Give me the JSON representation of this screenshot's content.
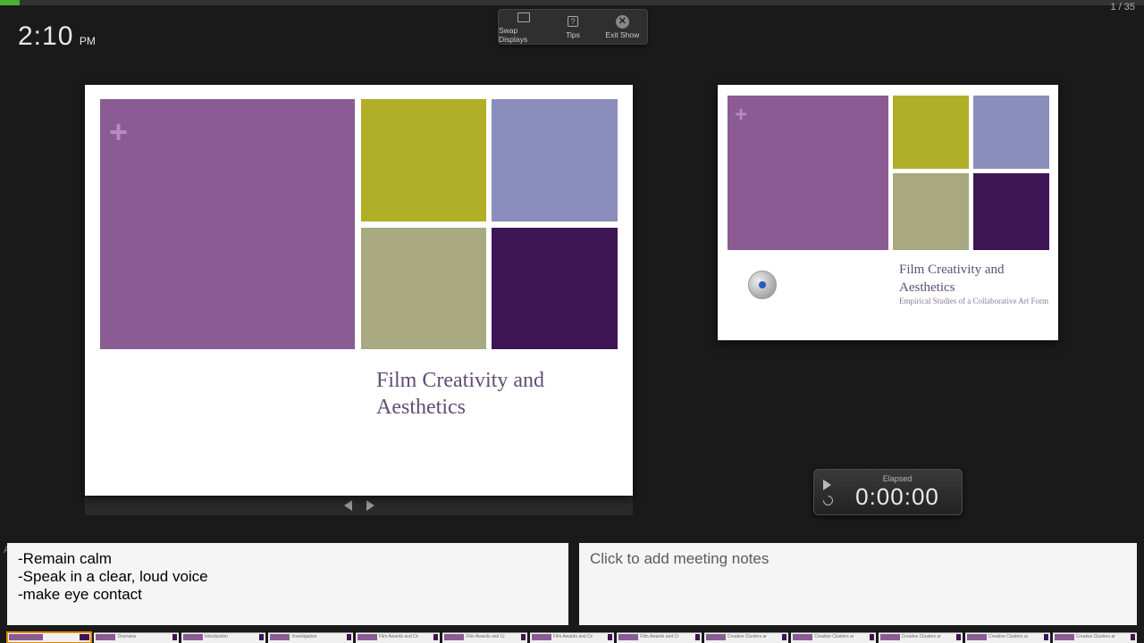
{
  "progress": {
    "current": 1,
    "total": 35,
    "label": "1 / 35"
  },
  "clock": {
    "time": "2:10",
    "ampm": "PM"
  },
  "toolbar": {
    "swap": "Swap Displays",
    "tips": "Tips",
    "exit": "Exit Show"
  },
  "current_slide": {
    "title": "Film Creativity and Aesthetics"
  },
  "next_slide": {
    "title": "Film Creativity and Aesthetics",
    "subtitle": "Empirical Studies of a Collaborative Art Form"
  },
  "timer": {
    "label": "Elapsed",
    "value": "0:00:00"
  },
  "presenter_notes": [
    "-Remain calm",
    "-Speak in a clear, loud voice",
    "-make eye contact"
  ],
  "meeting_notes_placeholder": "Click to add meeting notes",
  "thumbs": [
    "",
    "Overview",
    "Introduction",
    "Investigation",
    "Film Awards and Creative",
    "Film Awards and Creative",
    "Film Awards and Creative",
    "Film Awards and Creative",
    "Creative Clusters and",
    "Creative Clusters and",
    "Creative Clusters and",
    "Creative Clusters and",
    "Creative Clusters and"
  ]
}
